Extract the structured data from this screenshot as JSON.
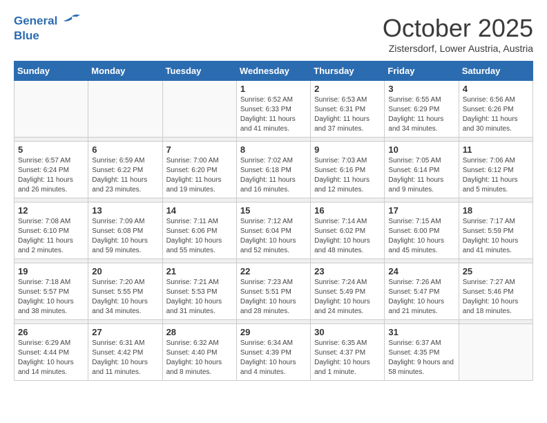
{
  "header": {
    "logo_line1": "General",
    "logo_line2": "Blue",
    "month": "October 2025",
    "location": "Zistersdorf, Lower Austria, Austria"
  },
  "weekdays": [
    "Sunday",
    "Monday",
    "Tuesday",
    "Wednesday",
    "Thursday",
    "Friday",
    "Saturday"
  ],
  "weeks": [
    [
      {
        "day": "",
        "sunrise": "",
        "sunset": "",
        "daylight": ""
      },
      {
        "day": "",
        "sunrise": "",
        "sunset": "",
        "daylight": ""
      },
      {
        "day": "",
        "sunrise": "",
        "sunset": "",
        "daylight": ""
      },
      {
        "day": "1",
        "sunrise": "Sunrise: 6:52 AM",
        "sunset": "Sunset: 6:33 PM",
        "daylight": "Daylight: 11 hours and 41 minutes."
      },
      {
        "day": "2",
        "sunrise": "Sunrise: 6:53 AM",
        "sunset": "Sunset: 6:31 PM",
        "daylight": "Daylight: 11 hours and 37 minutes."
      },
      {
        "day": "3",
        "sunrise": "Sunrise: 6:55 AM",
        "sunset": "Sunset: 6:29 PM",
        "daylight": "Daylight: 11 hours and 34 minutes."
      },
      {
        "day": "4",
        "sunrise": "Sunrise: 6:56 AM",
        "sunset": "Sunset: 6:26 PM",
        "daylight": "Daylight: 11 hours and 30 minutes."
      }
    ],
    [
      {
        "day": "5",
        "sunrise": "Sunrise: 6:57 AM",
        "sunset": "Sunset: 6:24 PM",
        "daylight": "Daylight: 11 hours and 26 minutes."
      },
      {
        "day": "6",
        "sunrise": "Sunrise: 6:59 AM",
        "sunset": "Sunset: 6:22 PM",
        "daylight": "Daylight: 11 hours and 23 minutes."
      },
      {
        "day": "7",
        "sunrise": "Sunrise: 7:00 AM",
        "sunset": "Sunset: 6:20 PM",
        "daylight": "Daylight: 11 hours and 19 minutes."
      },
      {
        "day": "8",
        "sunrise": "Sunrise: 7:02 AM",
        "sunset": "Sunset: 6:18 PM",
        "daylight": "Daylight: 11 hours and 16 minutes."
      },
      {
        "day": "9",
        "sunrise": "Sunrise: 7:03 AM",
        "sunset": "Sunset: 6:16 PM",
        "daylight": "Daylight: 11 hours and 12 minutes."
      },
      {
        "day": "10",
        "sunrise": "Sunrise: 7:05 AM",
        "sunset": "Sunset: 6:14 PM",
        "daylight": "Daylight: 11 hours and 9 minutes."
      },
      {
        "day": "11",
        "sunrise": "Sunrise: 7:06 AM",
        "sunset": "Sunset: 6:12 PM",
        "daylight": "Daylight: 11 hours and 5 minutes."
      }
    ],
    [
      {
        "day": "12",
        "sunrise": "Sunrise: 7:08 AM",
        "sunset": "Sunset: 6:10 PM",
        "daylight": "Daylight: 11 hours and 2 minutes."
      },
      {
        "day": "13",
        "sunrise": "Sunrise: 7:09 AM",
        "sunset": "Sunset: 6:08 PM",
        "daylight": "Daylight: 10 hours and 59 minutes."
      },
      {
        "day": "14",
        "sunrise": "Sunrise: 7:11 AM",
        "sunset": "Sunset: 6:06 PM",
        "daylight": "Daylight: 10 hours and 55 minutes."
      },
      {
        "day": "15",
        "sunrise": "Sunrise: 7:12 AM",
        "sunset": "Sunset: 6:04 PM",
        "daylight": "Daylight: 10 hours and 52 minutes."
      },
      {
        "day": "16",
        "sunrise": "Sunrise: 7:14 AM",
        "sunset": "Sunset: 6:02 PM",
        "daylight": "Daylight: 10 hours and 48 minutes."
      },
      {
        "day": "17",
        "sunrise": "Sunrise: 7:15 AM",
        "sunset": "Sunset: 6:00 PM",
        "daylight": "Daylight: 10 hours and 45 minutes."
      },
      {
        "day": "18",
        "sunrise": "Sunrise: 7:17 AM",
        "sunset": "Sunset: 5:59 PM",
        "daylight": "Daylight: 10 hours and 41 minutes."
      }
    ],
    [
      {
        "day": "19",
        "sunrise": "Sunrise: 7:18 AM",
        "sunset": "Sunset: 5:57 PM",
        "daylight": "Daylight: 10 hours and 38 minutes."
      },
      {
        "day": "20",
        "sunrise": "Sunrise: 7:20 AM",
        "sunset": "Sunset: 5:55 PM",
        "daylight": "Daylight: 10 hours and 34 minutes."
      },
      {
        "day": "21",
        "sunrise": "Sunrise: 7:21 AM",
        "sunset": "Sunset: 5:53 PM",
        "daylight": "Daylight: 10 hours and 31 minutes."
      },
      {
        "day": "22",
        "sunrise": "Sunrise: 7:23 AM",
        "sunset": "Sunset: 5:51 PM",
        "daylight": "Daylight: 10 hours and 28 minutes."
      },
      {
        "day": "23",
        "sunrise": "Sunrise: 7:24 AM",
        "sunset": "Sunset: 5:49 PM",
        "daylight": "Daylight: 10 hours and 24 minutes."
      },
      {
        "day": "24",
        "sunrise": "Sunrise: 7:26 AM",
        "sunset": "Sunset: 5:47 PM",
        "daylight": "Daylight: 10 hours and 21 minutes."
      },
      {
        "day": "25",
        "sunrise": "Sunrise: 7:27 AM",
        "sunset": "Sunset: 5:46 PM",
        "daylight": "Daylight: 10 hours and 18 minutes."
      }
    ],
    [
      {
        "day": "26",
        "sunrise": "Sunrise: 6:29 AM",
        "sunset": "Sunset: 4:44 PM",
        "daylight": "Daylight: 10 hours and 14 minutes."
      },
      {
        "day": "27",
        "sunrise": "Sunrise: 6:31 AM",
        "sunset": "Sunset: 4:42 PM",
        "daylight": "Daylight: 10 hours and 11 minutes."
      },
      {
        "day": "28",
        "sunrise": "Sunrise: 6:32 AM",
        "sunset": "Sunset: 4:40 PM",
        "daylight": "Daylight: 10 hours and 8 minutes."
      },
      {
        "day": "29",
        "sunrise": "Sunrise: 6:34 AM",
        "sunset": "Sunset: 4:39 PM",
        "daylight": "Daylight: 10 hours and 4 minutes."
      },
      {
        "day": "30",
        "sunrise": "Sunrise: 6:35 AM",
        "sunset": "Sunset: 4:37 PM",
        "daylight": "Daylight: 10 hours and 1 minute."
      },
      {
        "day": "31",
        "sunrise": "Sunrise: 6:37 AM",
        "sunset": "Sunset: 4:35 PM",
        "daylight": "Daylight: 9 hours and 58 minutes."
      },
      {
        "day": "",
        "sunrise": "",
        "sunset": "",
        "daylight": ""
      }
    ]
  ]
}
